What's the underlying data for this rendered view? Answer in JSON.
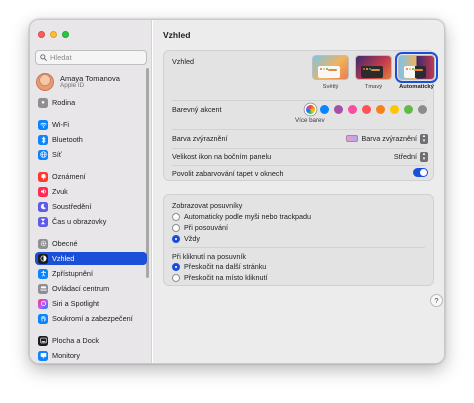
{
  "sidebar": {
    "search_placeholder": "Hledat",
    "profile": {
      "name": "Amaya Tomanova",
      "subtitle": "Apple ID"
    },
    "items": [
      {
        "label": "Rodina",
        "icon": "family-icon",
        "color": "#8e8e93"
      },
      {
        "label": "Wi-Fi",
        "icon": "wifi-icon",
        "color": "#0a84ff"
      },
      {
        "label": "Bluetooth",
        "icon": "bluetooth-icon",
        "color": "#0a84ff"
      },
      {
        "label": "Síť",
        "icon": "globe-icon",
        "color": "#0a84ff"
      },
      {
        "label": "Oznámení",
        "icon": "bell-icon",
        "color": "#ff3b30"
      },
      {
        "label": "Zvuk",
        "icon": "speaker-icon",
        "color": "#ff2d55"
      },
      {
        "label": "Soustředění",
        "icon": "moon-icon",
        "color": "#5e5ce6"
      },
      {
        "label": "Čas u obrazovky",
        "icon": "hourglass-icon",
        "color": "#5e5ce6"
      },
      {
        "label": "Obecné",
        "icon": "gear-icon",
        "color": "#8e8e93"
      },
      {
        "label": "Vzhled",
        "icon": "appearance-icon",
        "color": "#1d1d1f",
        "active": true
      },
      {
        "label": "Zpřístupnění",
        "icon": "accessibility-icon",
        "color": "#0a84ff"
      },
      {
        "label": "Ovládací centrum",
        "icon": "control-center-icon",
        "color": "#8e8e93"
      },
      {
        "label": "Siri a Spotlight",
        "icon": "siri-icon",
        "color": "#bf5af2"
      },
      {
        "label": "Soukromí a zabezpečení",
        "icon": "hand-icon",
        "color": "#0a84ff"
      },
      {
        "label": "Plocha a Dock",
        "icon": "dock-icon",
        "color": "#1d1d1f"
      },
      {
        "label": "Monitory",
        "icon": "display-icon",
        "color": "#0a84ff"
      }
    ]
  },
  "main": {
    "title": "Vzhled",
    "appearance": {
      "label": "Vzhled",
      "options": [
        {
          "label": "Světlý",
          "selected": false
        },
        {
          "label": "Tmavý",
          "selected": false
        },
        {
          "label": "Automatický",
          "selected": true
        }
      ]
    },
    "accent": {
      "label": "Barevný akcent",
      "caption": "Více barev",
      "colors": [
        "multicolor",
        "#0a84ff",
        "#a550a7",
        "#f74f9e",
        "#ff5257",
        "#f7821b",
        "#ffc600",
        "#62ba46",
        "#8c8c8c"
      ]
    },
    "highlight": {
      "label": "Barva zvýraznění",
      "value": "Barva zvýraznění"
    },
    "icon_size": {
      "label": "Velikost ikon na bočním panelu",
      "value": "Střední"
    },
    "wallpaper_tint": {
      "label": "Povolit zabarvování tapet v oknech",
      "on": true
    },
    "scrollbars": {
      "label": "Zobrazovat posuvníky",
      "options": [
        {
          "label": "Automaticky podle myši nebo trackpadu",
          "selected": false
        },
        {
          "label": "Při posouvání",
          "selected": false
        },
        {
          "label": "Vždy",
          "selected": true
        }
      ]
    },
    "scrollbar_click": {
      "label": "Při kliknutí na posuvník",
      "options": [
        {
          "label": "Přeskočit na další stránku",
          "selected": true
        },
        {
          "label": "Přeskočit na místo kliknutí",
          "selected": false
        }
      ]
    },
    "help_label": "?"
  },
  "colors": {
    "accent": "#1c4fd8",
    "sidebar_bg": "#e8e6e9",
    "content_bg": "#ececec"
  }
}
